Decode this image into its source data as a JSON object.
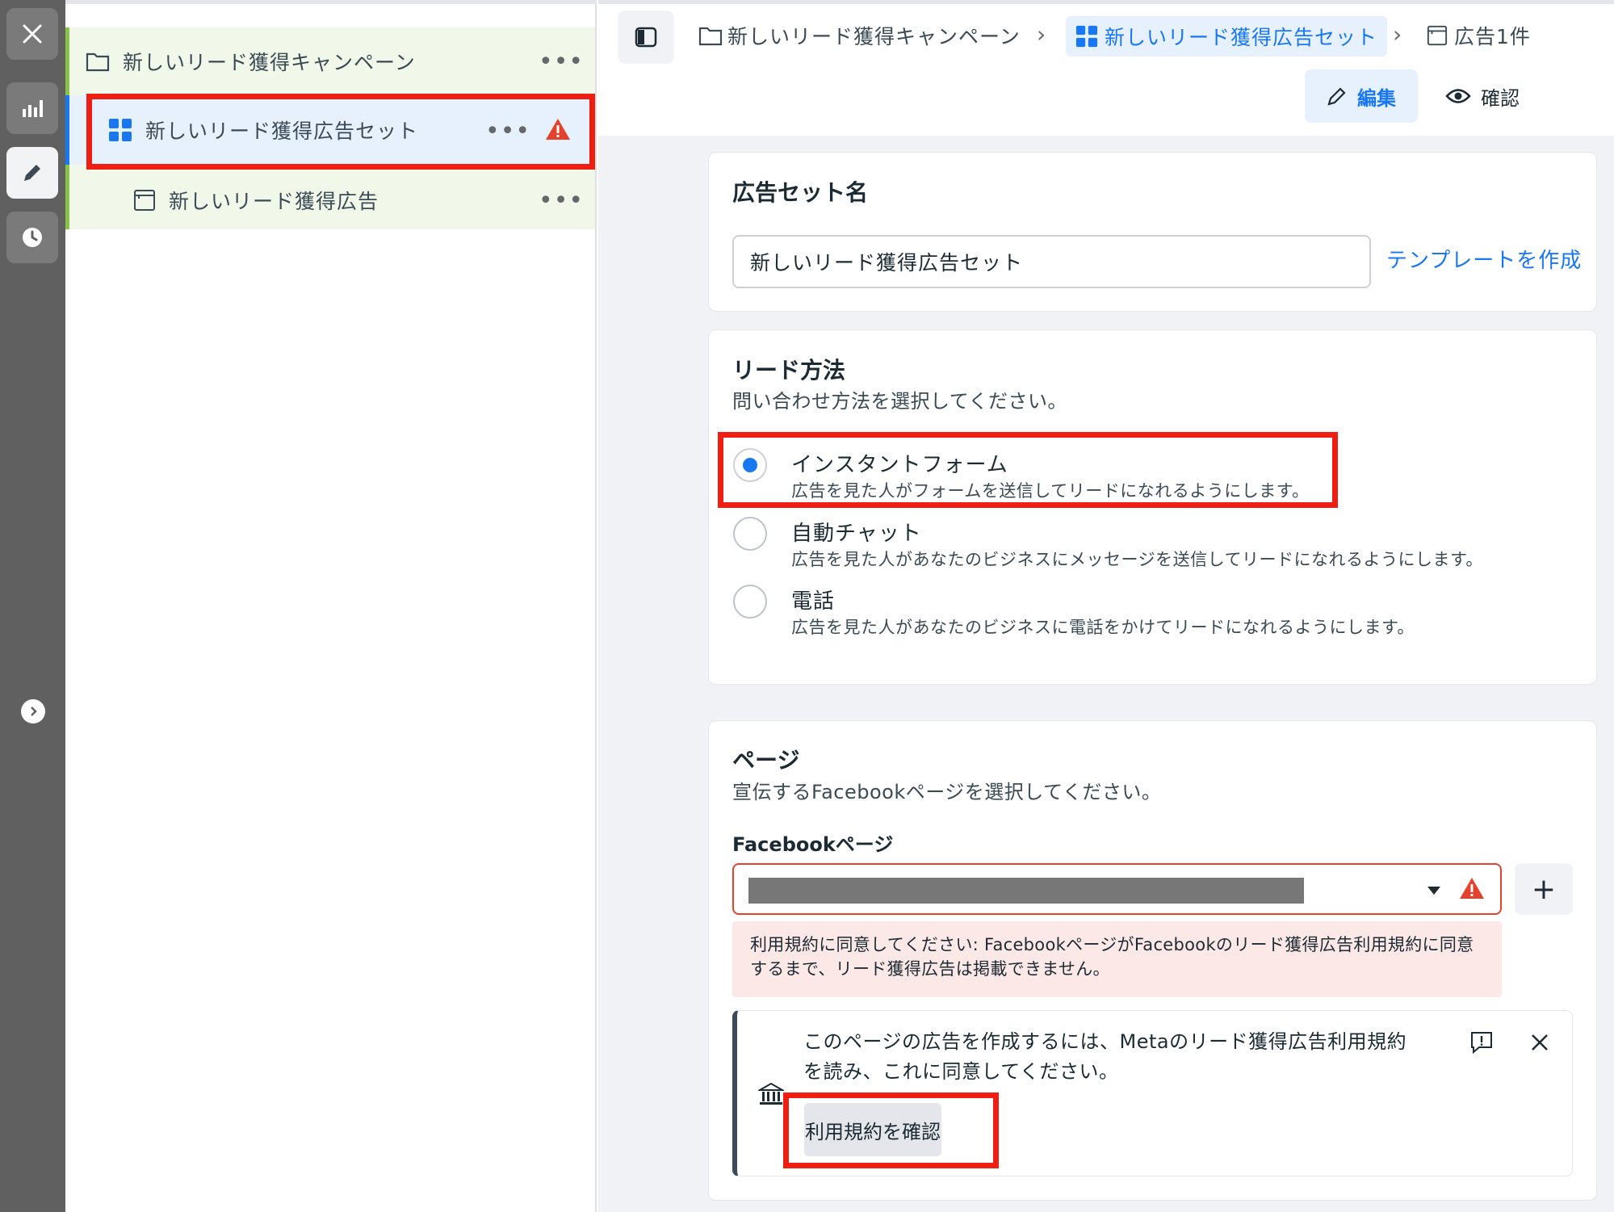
{
  "tree": {
    "campaign": "新しいリード獲得キャンペーン",
    "adset": "新しいリード獲得広告セット",
    "ad": "新しいリード獲得広告",
    "more": "•••"
  },
  "header": {
    "breadcrumbs": [
      "新しいリード獲得キャンペーン",
      "新しいリード獲得広告セット",
      "広告1件"
    ],
    "edit_label": "編集",
    "review_label": "確認"
  },
  "adset_name": {
    "title": "広告セット名",
    "value": "新しいリード獲得広告セット",
    "template_link": "テンプレートを作成"
  },
  "lead_method": {
    "title": "リード方法",
    "subtitle": "問い合わせ方法を選択してください。",
    "options": [
      {
        "title": "インスタントフォーム",
        "desc": "広告を見た人がフォームを送信してリードになれるようにします。",
        "selected": true
      },
      {
        "title": "自動チャット",
        "desc": "広告を見た人があなたのビジネスにメッセージを送信してリードになれるようにします。",
        "selected": false
      },
      {
        "title": "電話",
        "desc": "広告を見た人があなたのビジネスに電話をかけてリードになれるようにします。",
        "selected": false
      }
    ]
  },
  "page_section": {
    "title": "ページ",
    "subtitle": "宣伝するFacebookページを選択してください。",
    "field_label": "Facebookページ",
    "plus": "+",
    "error_line1": "利用規約に同意してください: FacebookページがFacebookのリード獲得広告利用規約に同意",
    "error_line2": "するまで、リード獲得広告は掲載できません。",
    "notice_line1": "このページの広告を作成するには、Metaのリード獲得広告利用規約",
    "notice_line2": "を読み、これに同意してください。",
    "terms_button": "利用規約を確認"
  },
  "colors": {
    "accent": "#1877f2",
    "highlight_red": "#ee1f12",
    "warning_red": "#e4422c",
    "tree_green": "#f1f8ea"
  }
}
